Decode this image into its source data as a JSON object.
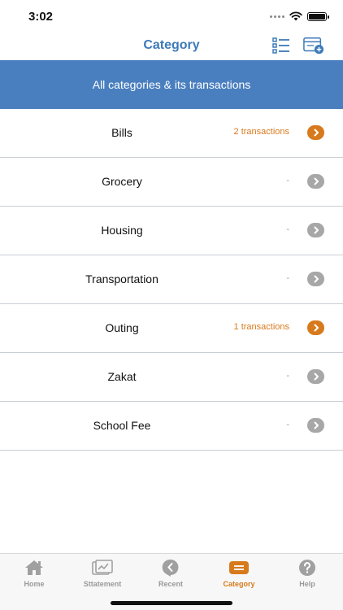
{
  "status_bar": {
    "time": "3:02",
    "icons": [
      "signal-icon",
      "wifi-icon",
      "battery-icon"
    ]
  },
  "header": {
    "title": "Category",
    "actions": [
      "list-view-icon",
      "add-category-icon"
    ]
  },
  "banner": {
    "text": "All categories & its transactions"
  },
  "categories": [
    {
      "name": "Bills",
      "count_label": "2 transactions",
      "has_transactions": true
    },
    {
      "name": "Grocery",
      "count_label": "-",
      "has_transactions": false
    },
    {
      "name": "Housing",
      "count_label": "-",
      "has_transactions": false
    },
    {
      "name": "Transportation",
      "count_label": "-",
      "has_transactions": false
    },
    {
      "name": "Outing",
      "count_label": "1 transactions",
      "has_transactions": true
    },
    {
      "name": "Zakat",
      "count_label": "-",
      "has_transactions": false
    },
    {
      "name": "School Fee",
      "count_label": "-",
      "has_transactions": false
    }
  ],
  "tabs": [
    {
      "label": "Home",
      "icon": "home-icon",
      "active": false
    },
    {
      "label": "Sttatement",
      "icon": "statement-icon",
      "active": false
    },
    {
      "label": "Recent",
      "icon": "recent-icon",
      "active": false
    },
    {
      "label": "Category",
      "icon": "category-icon",
      "active": true
    },
    {
      "label": "Help",
      "icon": "help-icon",
      "active": false
    }
  ],
  "colors": {
    "primary_blue": "#4a7fbf",
    "title_blue": "#3d7ab8",
    "accent_orange": "#d77a1c",
    "inactive_gray": "#a7a7a7"
  }
}
